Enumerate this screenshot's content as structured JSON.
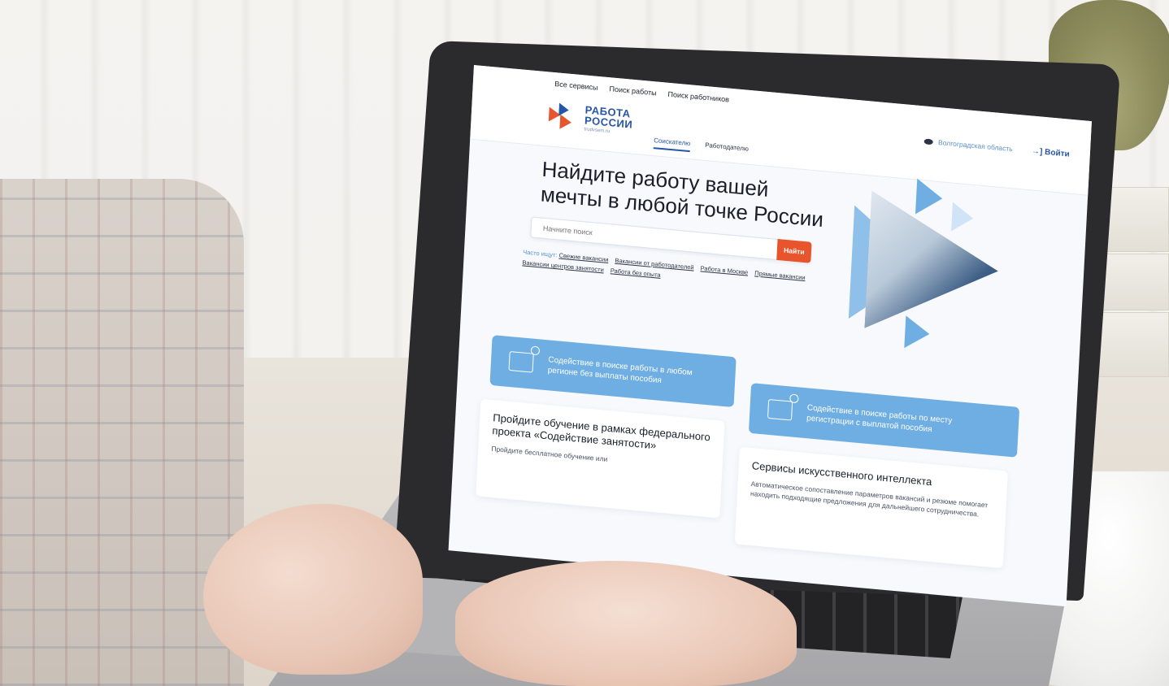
{
  "topbar": {
    "all_services": "Все сервисы",
    "job_search": "Поиск работы",
    "worker_search": "Поиск работников"
  },
  "brand": {
    "line1": "РАБОТА",
    "line2": "РОССИИ",
    "domain": "trudvsem.ru",
    "colors": {
      "blue": "#2656a7",
      "red": "#e8542c",
      "light_blue": "#6faee3"
    }
  },
  "header": {
    "tabs": [
      {
        "label": "Соискателю",
        "active": true
      },
      {
        "label": "Работодателю",
        "active": false
      }
    ],
    "region": "Волгоградская область",
    "login": "Войти"
  },
  "hero": {
    "title": "Найдите работу вашей мечты в любой точке России",
    "search_placeholder": "Начните поиск",
    "search_button": "Найти",
    "popular_label": "Часто ищут:",
    "popular_links": [
      "Свежие вакансии",
      "Вакансии от работодателей",
      "Работа в Москве",
      "Прямые вакансии",
      "Вакансии центров занятости",
      "Работа без опыта"
    ]
  },
  "cards": {
    "assist_any_region": "Содействие в поиске работы в любом регионе без выплаты пособия",
    "assist_registration": "Содействие в поиске работы по месту регистрации с выплатой пособия",
    "training_title": "Пройдите обучение в рамках федерального проекта «Содействие занятости»",
    "training_text": "Пройдите бесплатное обучение или",
    "ai_title": "Сервисы искусственного интеллекта",
    "ai_text": "Автоматическое сопоставление параметров вакансий и резюме помогает находить подходящие предложения для дальнейшего сотрудничества."
  }
}
